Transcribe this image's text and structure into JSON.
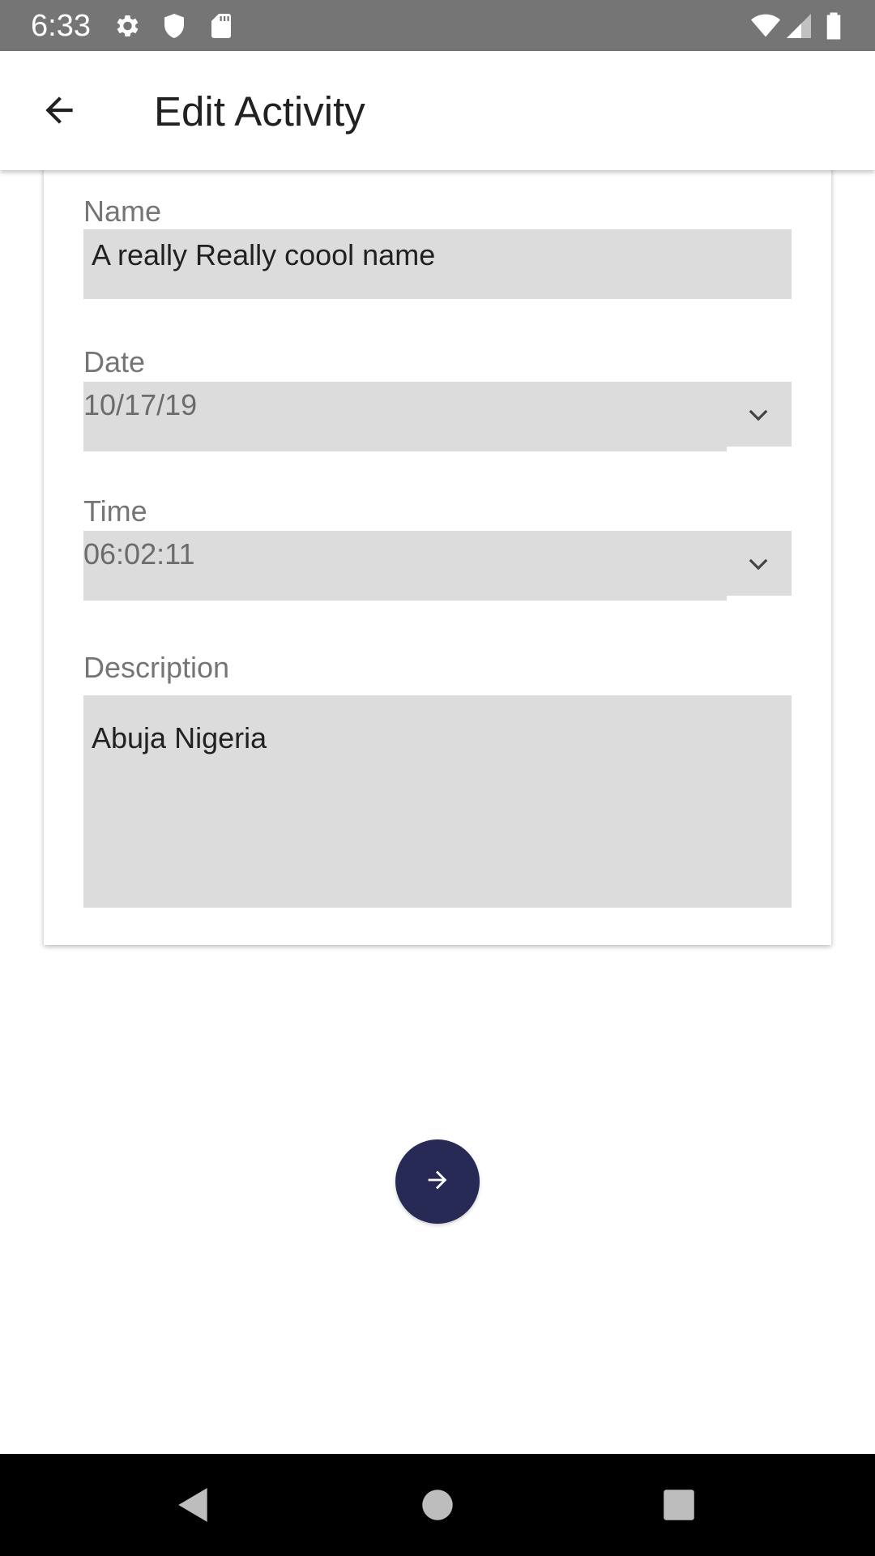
{
  "status_bar": {
    "time": "6:33",
    "icons": [
      "gear-icon",
      "shield-icon",
      "sd-card-icon",
      "wifi-icon",
      "signal-icon",
      "battery-icon"
    ]
  },
  "app_bar": {
    "title": "Edit Activity",
    "back_icon": "arrow-left-icon"
  },
  "form": {
    "name": {
      "label": "Name",
      "value": "A really Really coool name"
    },
    "date": {
      "label": "Date",
      "value": "10/17/19",
      "icon": "chevron-down-icon"
    },
    "time": {
      "label": "Time",
      "value": "06:02:11",
      "icon": "chevron-down-icon"
    },
    "description": {
      "label": "Description",
      "value": "Abuja Nigeria"
    }
  },
  "fab": {
    "icon": "arrow-right-icon",
    "color": "#272a55"
  },
  "nav_bar": {
    "icons": [
      "back-triangle-icon",
      "home-circle-icon",
      "recents-square-icon"
    ]
  },
  "colors": {
    "status_bar": "#757575",
    "field_background": "#dcdcdc",
    "label_text": "#757575",
    "fab_background": "#272a55"
  }
}
